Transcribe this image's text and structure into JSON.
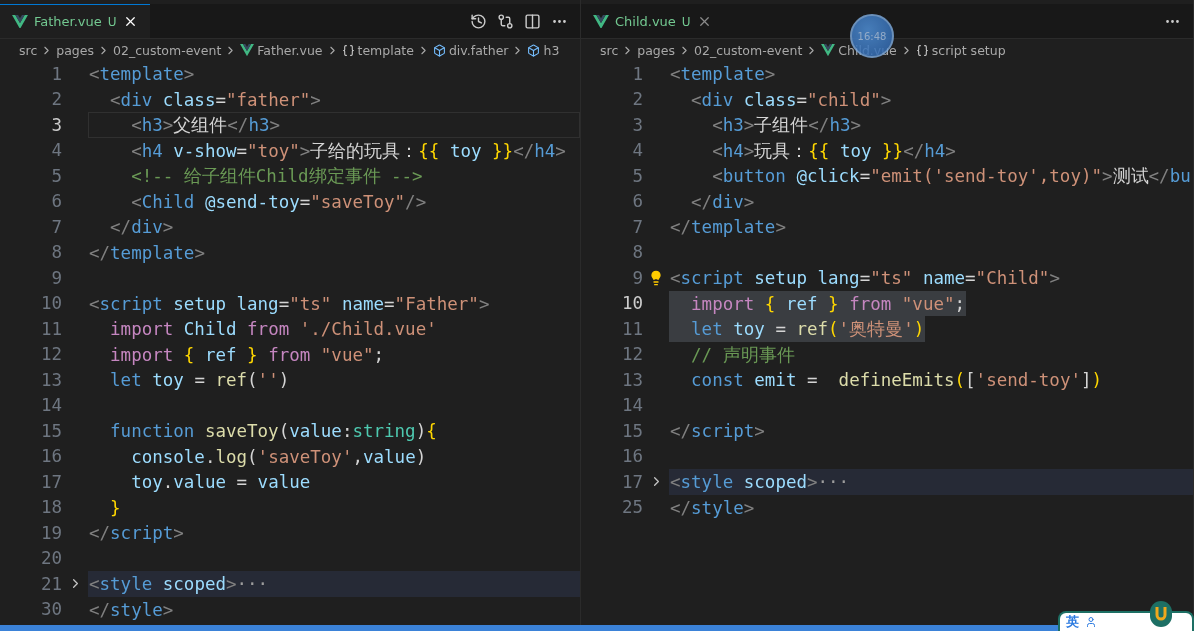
{
  "panes": [
    {
      "tab": {
        "title": "Father.vue",
        "status": "U",
        "selected": true
      },
      "breadcrumbs": [
        {
          "kind": "folder",
          "text": "src"
        },
        {
          "kind": "folder",
          "text": "pages"
        },
        {
          "kind": "folder",
          "text": "02_custom-event"
        },
        {
          "kind": "file",
          "text": "Father.vue"
        },
        {
          "kind": "braces",
          "text": "template"
        },
        {
          "kind": "element",
          "text": "div.father"
        },
        {
          "kind": "element",
          "text": "h3"
        }
      ],
      "lines": [
        {
          "number": "1",
          "tokens": [
            {
              "kind": "punct",
              "text": "<"
            },
            {
              "kind": "tag",
              "text": "template"
            },
            {
              "kind": "punct",
              "text": ">"
            }
          ]
        },
        {
          "number": "2",
          "tokens": [
            {
              "kind": "punct",
              "text": "  <"
            },
            {
              "kind": "tag",
              "text": "div"
            },
            {
              "kind": "attr",
              "text": " class"
            },
            {
              "kind": "plain",
              "text": "="
            },
            {
              "kind": "string",
              "text": "\"father\""
            },
            {
              "kind": "punct",
              "text": ">"
            }
          ]
        },
        {
          "number": "3",
          "current": true,
          "tokens": [
            {
              "kind": "punct",
              "text": "    <"
            },
            {
              "kind": "tag",
              "text": "h3"
            },
            {
              "kind": "punct",
              "text": ">"
            },
            {
              "kind": "plain",
              "text": "父组件"
            },
            {
              "kind": "punct",
              "text": "</"
            },
            {
              "kind": "tag",
              "text": "h3"
            },
            {
              "kind": "punct",
              "text": ">"
            }
          ]
        },
        {
          "number": "4",
          "tokens": [
            {
              "kind": "punct",
              "text": "    <"
            },
            {
              "kind": "tag",
              "text": "h4"
            },
            {
              "kind": "attr",
              "text": " v-show"
            },
            {
              "kind": "plain",
              "text": "="
            },
            {
              "kind": "string",
              "text": "\"toy\""
            },
            {
              "kind": "punct",
              "text": ">"
            },
            {
              "kind": "plain",
              "text": "子给的玩具："
            },
            {
              "kind": "brace",
              "text": "{{"
            },
            {
              "kind": "variable",
              "text": " toy "
            },
            {
              "kind": "brace",
              "text": "}}"
            },
            {
              "kind": "punct",
              "text": "</"
            },
            {
              "kind": "tag",
              "text": "h4"
            },
            {
              "kind": "punct",
              "text": ">"
            }
          ]
        },
        {
          "number": "5",
          "tokens": [
            {
              "kind": "comment",
              "text": "    <!-- 给子组件Child绑定事件 -->"
            }
          ]
        },
        {
          "number": "6",
          "tokens": [
            {
              "kind": "punct",
              "text": "    <"
            },
            {
              "kind": "tag",
              "text": "Child"
            },
            {
              "kind": "attr",
              "text": " @send-toy"
            },
            {
              "kind": "plain",
              "text": "="
            },
            {
              "kind": "string",
              "text": "\"saveToy\""
            },
            {
              "kind": "punct",
              "text": "/>"
            }
          ]
        },
        {
          "number": "7",
          "tokens": [
            {
              "kind": "punct",
              "text": "  </"
            },
            {
              "kind": "tag",
              "text": "div"
            },
            {
              "kind": "punct",
              "text": ">"
            }
          ]
        },
        {
          "number": "8",
          "tokens": [
            {
              "kind": "punct",
              "text": "</"
            },
            {
              "kind": "tag",
              "text": "template"
            },
            {
              "kind": "punct",
              "text": ">"
            }
          ]
        },
        {
          "number": "9"
        },
        {
          "number": "10",
          "tokens": [
            {
              "kind": "punct",
              "text": "<"
            },
            {
              "kind": "tag",
              "text": "script"
            },
            {
              "kind": "attr",
              "text": " setup lang"
            },
            {
              "kind": "plain",
              "text": "="
            },
            {
              "kind": "string",
              "text": "\"ts\""
            },
            {
              "kind": "attr",
              "text": " name"
            },
            {
              "kind": "plain",
              "text": "="
            },
            {
              "kind": "string",
              "text": "\"Father\""
            },
            {
              "kind": "punct",
              "text": ">"
            }
          ]
        },
        {
          "number": "11",
          "tokens": [
            {
              "kind": "keyword",
              "text": "  import"
            },
            {
              "kind": "variable",
              "text": " Child "
            },
            {
              "kind": "keyword",
              "text": "from"
            },
            {
              "kind": "string",
              "text": " './Child.vue'"
            }
          ]
        },
        {
          "number": "12",
          "tokens": [
            {
              "kind": "keyword",
              "text": "  import"
            },
            {
              "kind": "brace",
              "text": " {"
            },
            {
              "kind": "variable",
              "text": " ref "
            },
            {
              "kind": "brace",
              "text": "}"
            },
            {
              "kind": "keyword",
              "text": " from"
            },
            {
              "kind": "string",
              "text": " \"vue\""
            },
            {
              "kind": "plain",
              "text": ";"
            }
          ]
        },
        {
          "number": "13",
          "tokens": [
            {
              "kind": "storage",
              "text": "  let"
            },
            {
              "kind": "variable",
              "text": " toy"
            },
            {
              "kind": "plain",
              "text": " = "
            },
            {
              "kind": "function",
              "text": "ref"
            },
            {
              "kind": "plain",
              "text": "("
            },
            {
              "kind": "string",
              "text": "''"
            },
            {
              "kind": "plain",
              "text": ")"
            }
          ]
        },
        {
          "number": "14"
        },
        {
          "number": "15",
          "tokens": [
            {
              "kind": "storage",
              "text": "  function"
            },
            {
              "kind": "function",
              "text": " saveToy"
            },
            {
              "kind": "plain",
              "text": "("
            },
            {
              "kind": "variable",
              "text": "value"
            },
            {
              "kind": "plain",
              "text": ":"
            },
            {
              "kind": "type",
              "text": "string"
            },
            {
              "kind": "plain",
              "text": ")"
            },
            {
              "kind": "brace",
              "text": "{"
            }
          ]
        },
        {
          "number": "16",
          "tokens": [
            {
              "kind": "variable",
              "text": "    console"
            },
            {
              "kind": "plain",
              "text": "."
            },
            {
              "kind": "function",
              "text": "log"
            },
            {
              "kind": "plain",
              "text": "("
            },
            {
              "kind": "string",
              "text": "'saveToy'"
            },
            {
              "kind": "plain",
              "text": ","
            },
            {
              "kind": "variable",
              "text": "value"
            },
            {
              "kind": "plain",
              "text": ")"
            }
          ]
        },
        {
          "number": "17",
          "tokens": [
            {
              "kind": "variable",
              "text": "    toy"
            },
            {
              "kind": "plain",
              "text": "."
            },
            {
              "kind": "variable",
              "text": "value"
            },
            {
              "kind": "plain",
              "text": " = "
            },
            {
              "kind": "variable",
              "text": "value"
            }
          ]
        },
        {
          "number": "18",
          "tokens": [
            {
              "kind": "brace",
              "text": "  }"
            }
          ]
        },
        {
          "number": "19",
          "tokens": [
            {
              "kind": "punct",
              "text": "</"
            },
            {
              "kind": "tag",
              "text": "script"
            },
            {
              "kind": "punct",
              "text": ">"
            }
          ]
        },
        {
          "number": "20"
        },
        {
          "number": "21",
          "folded": true,
          "tokens": [
            {
              "kind": "punct",
              "text": "<"
            },
            {
              "kind": "tag",
              "text": "style"
            },
            {
              "kind": "attr",
              "text": " scoped"
            },
            {
              "kind": "punct",
              "text": ">"
            },
            {
              "kind": "ellipsis",
              "text": "···"
            }
          ]
        },
        {
          "number": "30",
          "tokens": [
            {
              "kind": "punct",
              "text": "</"
            },
            {
              "kind": "tag",
              "text": "style"
            },
            {
              "kind": "punct",
              "text": ">"
            }
          ]
        }
      ]
    },
    {
      "tab": {
        "title": "Child.vue",
        "status": "U",
        "selected": false
      },
      "breadcrumbs": [
        {
          "kind": "folder",
          "text": "src"
        },
        {
          "kind": "folder",
          "text": "pages"
        },
        {
          "kind": "folder",
          "text": "02_custom-event"
        },
        {
          "kind": "file",
          "text": "Child.vue"
        },
        {
          "kind": "braces",
          "text": "script setup"
        }
      ],
      "lines": [
        {
          "number": "1",
          "tokens": [
            {
              "kind": "punct",
              "text": "<"
            },
            {
              "kind": "tag",
              "text": "template"
            },
            {
              "kind": "punct",
              "text": ">"
            }
          ]
        },
        {
          "number": "2",
          "tokens": [
            {
              "kind": "punct",
              "text": "  <"
            },
            {
              "kind": "tag",
              "text": "div"
            },
            {
              "kind": "attr",
              "text": " class"
            },
            {
              "kind": "plain",
              "text": "="
            },
            {
              "kind": "string",
              "text": "\"child\""
            },
            {
              "kind": "punct",
              "text": ">"
            }
          ]
        },
        {
          "number": "3",
          "tokens": [
            {
              "kind": "punct",
              "text": "    <"
            },
            {
              "kind": "tag",
              "text": "h3"
            },
            {
              "kind": "punct",
              "text": ">"
            },
            {
              "kind": "plain",
              "text": "子组件"
            },
            {
              "kind": "punct",
              "text": "</"
            },
            {
              "kind": "tag",
              "text": "h3"
            },
            {
              "kind": "punct",
              "text": ">"
            }
          ]
        },
        {
          "number": "4",
          "tokens": [
            {
              "kind": "punct",
              "text": "    <"
            },
            {
              "kind": "tag",
              "text": "h4"
            },
            {
              "kind": "punct",
              "text": ">"
            },
            {
              "kind": "plain",
              "text": "玩具："
            },
            {
              "kind": "brace",
              "text": "{{"
            },
            {
              "kind": "variable",
              "text": " toy "
            },
            {
              "kind": "brace",
              "text": "}}"
            },
            {
              "kind": "punct",
              "text": "</"
            },
            {
              "kind": "tag",
              "text": "h4"
            },
            {
              "kind": "punct",
              "text": ">"
            }
          ]
        },
        {
          "number": "5",
          "tokens": [
            {
              "kind": "punct",
              "text": "    <"
            },
            {
              "kind": "tag",
              "text": "button"
            },
            {
              "kind": "attr",
              "text": " @click"
            },
            {
              "kind": "plain",
              "text": "="
            },
            {
              "kind": "string",
              "text": "\"emit('send-toy',toy)\""
            },
            {
              "kind": "punct",
              "text": ">"
            },
            {
              "kind": "plain",
              "text": "测试"
            },
            {
              "kind": "punct",
              "text": "</"
            },
            {
              "kind": "tag",
              "text": "bu"
            }
          ]
        },
        {
          "number": "6",
          "tokens": [
            {
              "kind": "punct",
              "text": "  </"
            },
            {
              "kind": "tag",
              "text": "div"
            },
            {
              "kind": "punct",
              "text": ">"
            }
          ]
        },
        {
          "number": "7",
          "tokens": [
            {
              "kind": "punct",
              "text": "</"
            },
            {
              "kind": "tag",
              "text": "template"
            },
            {
              "kind": "punct",
              "text": ">"
            }
          ]
        },
        {
          "number": "8"
        },
        {
          "number": "9",
          "hint": true,
          "tokens": [
            {
              "kind": "punct",
              "text": "<"
            },
            {
              "kind": "tag",
              "text": "script"
            },
            {
              "kind": "attr",
              "text": " setup lang"
            },
            {
              "kind": "plain",
              "text": "="
            },
            {
              "kind": "string",
              "text": "\"ts\""
            },
            {
              "kind": "attr",
              "text": " name"
            },
            {
              "kind": "plain",
              "text": "="
            },
            {
              "kind": "string",
              "text": "\"Child\""
            },
            {
              "kind": "punct",
              "text": ">"
            }
          ]
        },
        {
          "number": "10",
          "current": true,
          "selected": true,
          "tokens": [
            {
              "kind": "keyword",
              "text": "  import"
            },
            {
              "kind": "brace",
              "text": " {"
            },
            {
              "kind": "variable",
              "text": " ref "
            },
            {
              "kind": "brace",
              "text": "}"
            },
            {
              "kind": "keyword",
              "text": " from"
            },
            {
              "kind": "string",
              "text": " \"vue\""
            },
            {
              "kind": "plain",
              "text": ";"
            }
          ]
        },
        {
          "number": "11",
          "selected": true,
          "tokens": [
            {
              "kind": "storage",
              "text": "  let"
            },
            {
              "kind": "variable",
              "text": " toy"
            },
            {
              "kind": "plain",
              "text": " = "
            },
            {
              "kind": "function",
              "text": "ref"
            },
            {
              "kind": "brace",
              "text": "("
            },
            {
              "kind": "string",
              "text": "'奥特曼'"
            },
            {
              "kind": "brace",
              "text": ")"
            }
          ]
        },
        {
          "number": "12",
          "tokens": [
            {
              "kind": "comment",
              "text": "  // 声明事件"
            }
          ]
        },
        {
          "number": "13",
          "tokens": [
            {
              "kind": "storage",
              "text": "  const"
            },
            {
              "kind": "variable",
              "text": " emit"
            },
            {
              "kind": "plain",
              "text": " =  "
            },
            {
              "kind": "function",
              "text": "defineEmits"
            },
            {
              "kind": "brace",
              "text": "("
            },
            {
              "kind": "plain",
              "text": "["
            },
            {
              "kind": "string",
              "text": "'send-toy'"
            },
            {
              "kind": "plain",
              "text": "]"
            },
            {
              "kind": "brace",
              "text": ")"
            }
          ]
        },
        {
          "number": "14"
        },
        {
          "number": "15",
          "tokens": [
            {
              "kind": "punct",
              "text": "</"
            },
            {
              "kind": "tag",
              "text": "script"
            },
            {
              "kind": "punct",
              "text": ">"
            }
          ]
        },
        {
          "number": "16"
        },
        {
          "number": "17",
          "folded": true,
          "tokens": [
            {
              "kind": "punct",
              "text": "<"
            },
            {
              "kind": "tag",
              "text": "style"
            },
            {
              "kind": "attr",
              "text": " scoped"
            },
            {
              "kind": "punct",
              "text": ">"
            },
            {
              "kind": "ellipsis",
              "text": "···"
            }
          ]
        },
        {
          "number": "25",
          "tokens": [
            {
              "kind": "punct",
              "text": "</"
            },
            {
              "kind": "tag",
              "text": "style"
            },
            {
              "kind": "punct",
              "text": ">"
            }
          ]
        }
      ]
    }
  ],
  "clock": "16:48",
  "ime": {
    "mode": "英"
  }
}
